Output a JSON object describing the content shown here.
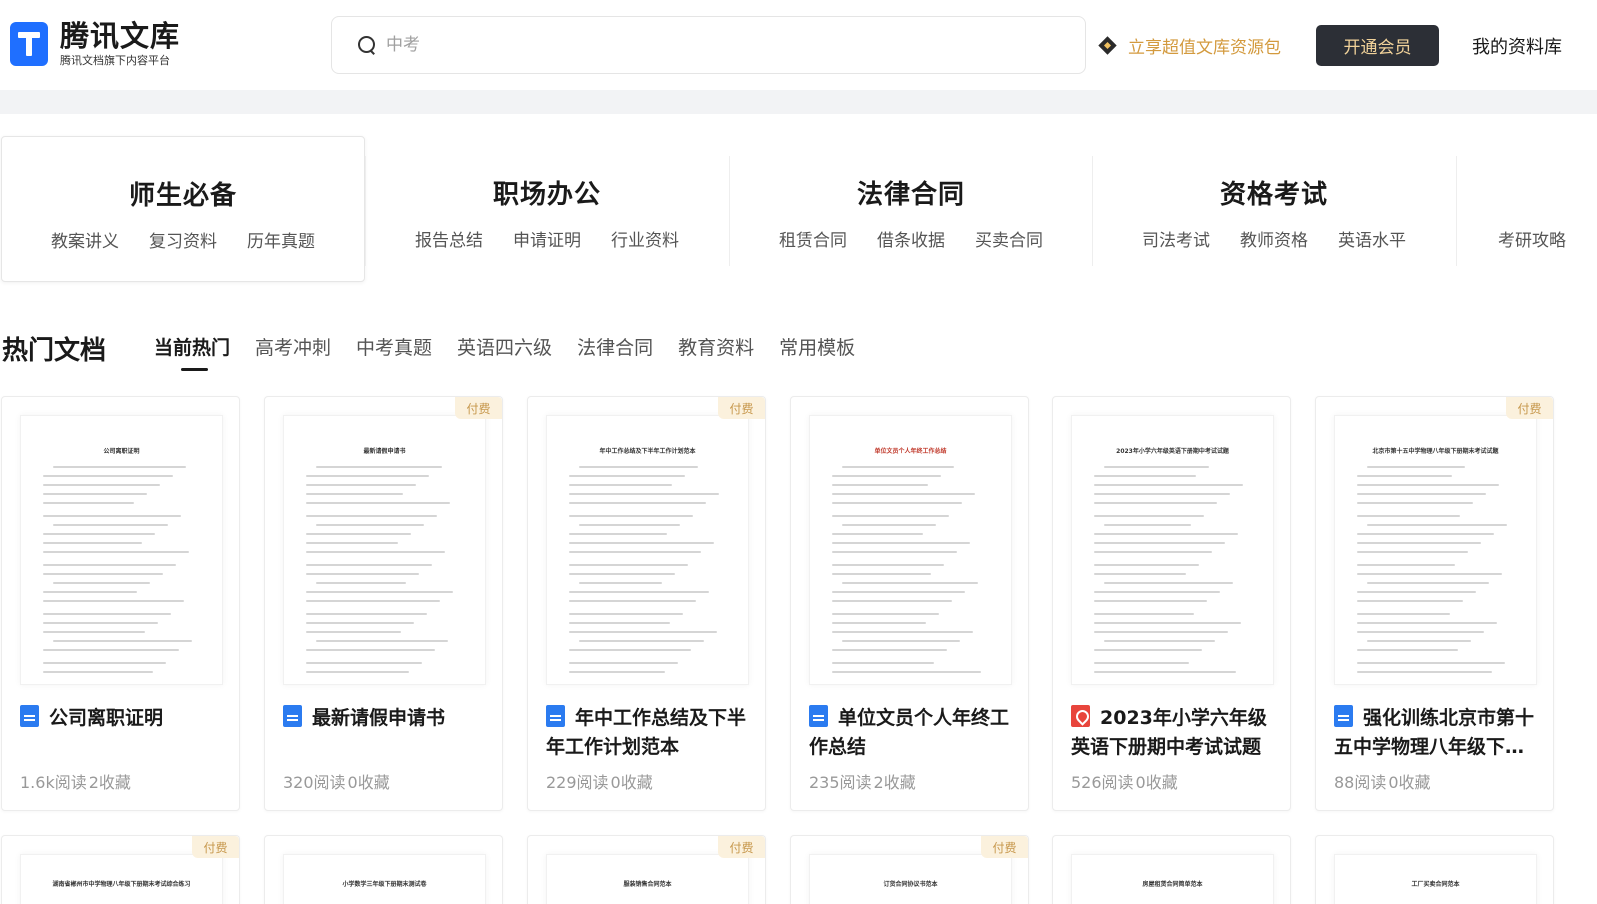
{
  "header": {
    "logo_title": "腾讯文库",
    "logo_subtitle": "腾讯文档旗下内容平台",
    "search_placeholder": "中考",
    "promo_text": "立享超值文库资源包",
    "vip_button": "开通会员",
    "my_library": "我的资料库"
  },
  "categories": [
    {
      "title": "师生必备",
      "links": [
        "教案讲义",
        "复习资料",
        "历年真题"
      ]
    },
    {
      "title": "职场办公",
      "links": [
        "报告总结",
        "申请证明",
        "行业资料"
      ]
    },
    {
      "title": "法律合同",
      "links": [
        "租赁合同",
        "借条收据",
        "买卖合同"
      ]
    },
    {
      "title": "资格考试",
      "links": [
        "司法考试",
        "教师资格",
        "英语水平"
      ]
    },
    {
      "title": "",
      "links": [
        "考研攻略"
      ]
    }
  ],
  "hot": {
    "title": "热门文档",
    "tabs": [
      "当前热门",
      "高考冲刺",
      "中考真题",
      "英语四六级",
      "法律合同",
      "教育资料",
      "常用模板"
    ]
  },
  "paid_label": "付费",
  "docs": [
    {
      "title": "公司离职证明",
      "type": "word",
      "reads": "1.6k阅读",
      "favs": "2收藏",
      "paid": false,
      "thumb_title": "公司离职证明"
    },
    {
      "title": "最新请假申请书",
      "type": "word",
      "reads": "320阅读",
      "favs": "0收藏",
      "paid": true,
      "thumb_title": "最新请假申请书"
    },
    {
      "title": "年中工作总结及下半年工作计划范本",
      "type": "word",
      "reads": "229阅读",
      "favs": "0收藏",
      "paid": true,
      "thumb_title": "年中工作总结及下半年工作计划范本"
    },
    {
      "title": "单位文员个人年终工作总结",
      "type": "word",
      "reads": "235阅读",
      "favs": "2收藏",
      "paid": false,
      "thumb_title": "单位文员个人年终工作总结"
    },
    {
      "title": "2023年小学六年级英语下册期中考试试题",
      "type": "pdf",
      "reads": "526阅读",
      "favs": "0收藏",
      "paid": false,
      "thumb_title": "2023年小学六年级英语下册期中考试试题"
    },
    {
      "title": "强化训练北京市第十五中学物理八年级下册期末考试试题",
      "type": "word",
      "reads": "88阅读",
      "favs": "0收藏",
      "paid": true,
      "thumb_title": "北京市第十五中学物理八年级下册期末考试试题"
    }
  ],
  "docs_row2": [
    {
      "paid": true,
      "thumb_title": "湖南省郴州市中学物理八年级下册期末考试综合练习"
    },
    {
      "paid": false,
      "thumb_title": "小学数学三年级下册期末测试卷"
    },
    {
      "paid": true,
      "thumb_title": "服装销售合同范本"
    },
    {
      "paid": true,
      "thumb_title": "订货合同协议书范本"
    },
    {
      "paid": false,
      "thumb_title": "房屋租赁合同简单范本"
    },
    {
      "paid": false,
      "thumb_title": "工厂买卖合同范本"
    }
  ]
}
